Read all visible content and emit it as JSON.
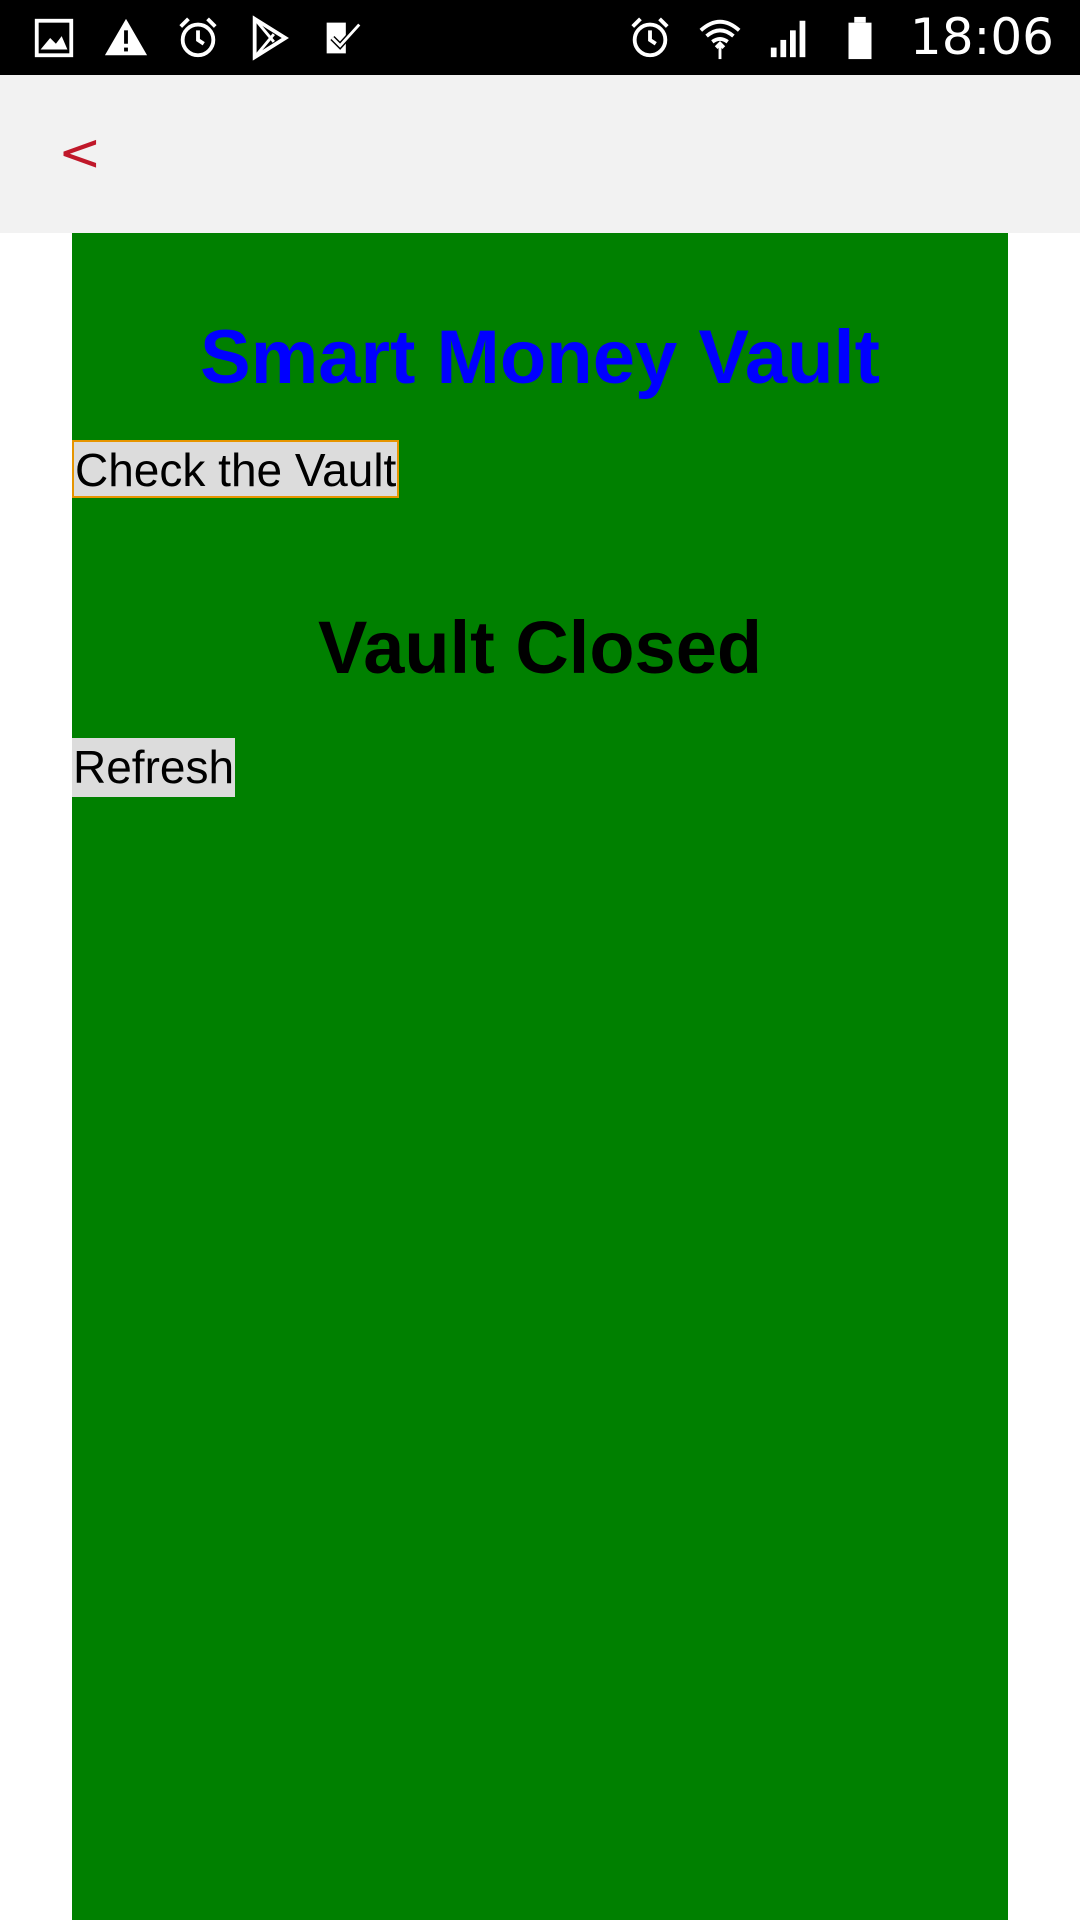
{
  "status_bar": {
    "left_icons": [
      "gallery-icon",
      "warning-icon",
      "alarm-icon",
      "play-store-icon",
      "task-check-icon"
    ],
    "right_icons": [
      "alarm-icon",
      "wifi-icon",
      "signal-icon",
      "battery-icon"
    ],
    "time": "18:06"
  },
  "nav": {
    "back_label": "<",
    "back_color": "#c0182a"
  },
  "main": {
    "background_color": "#008000",
    "title": "Smart Money Vault",
    "title_color": "#0000ff",
    "check_button_label": "Check the Vault",
    "status_text": "Vault Closed",
    "refresh_button_label": "Refresh"
  }
}
